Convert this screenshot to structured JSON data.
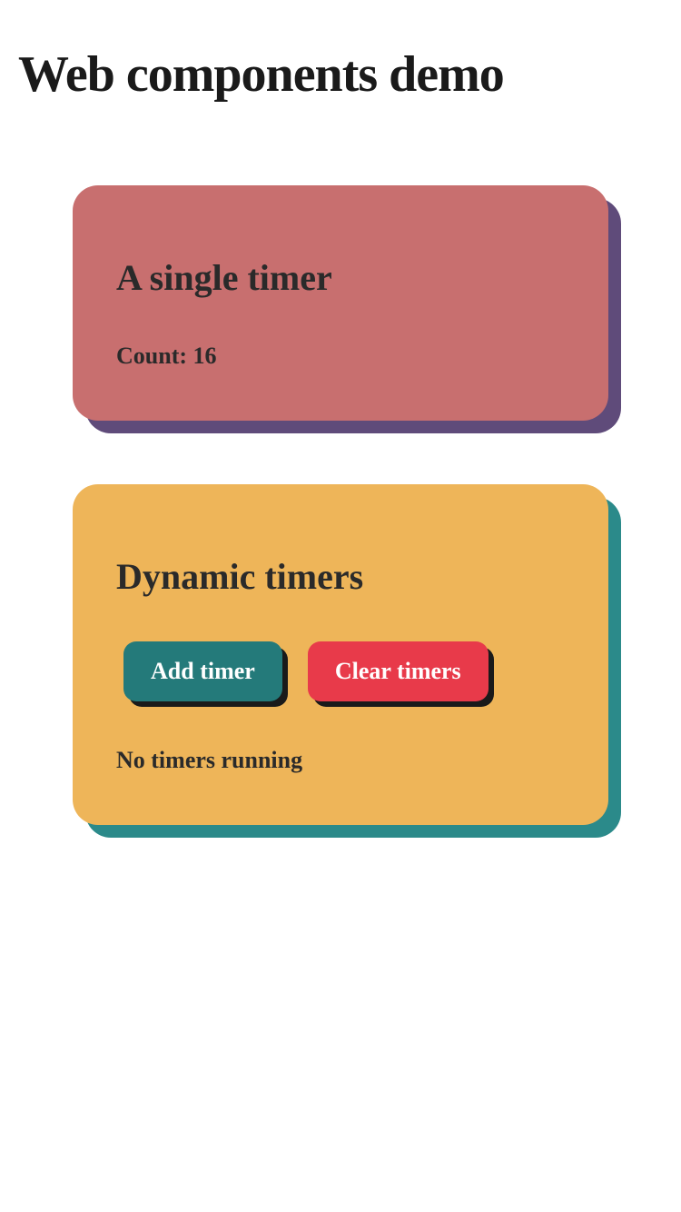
{
  "page": {
    "title": "Web components demo"
  },
  "single_timer": {
    "heading": "A single timer",
    "count_text": "Count: 16"
  },
  "dynamic_timers": {
    "heading": "Dynamic timers",
    "add_button": "Add timer",
    "clear_button": "Clear timers",
    "status": "No timers running"
  }
}
